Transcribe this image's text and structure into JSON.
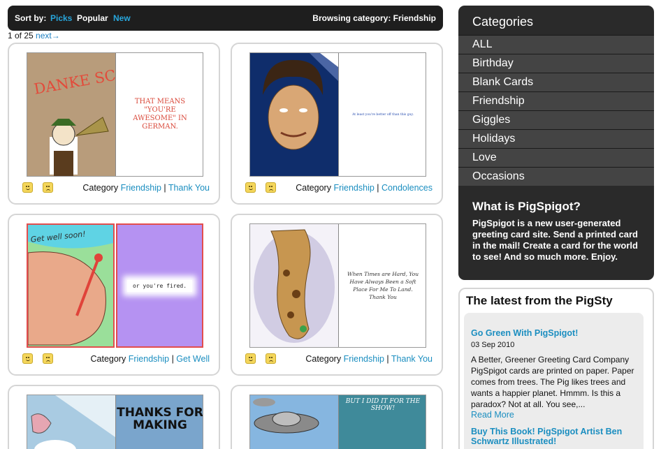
{
  "sortbar": {
    "sort_label": "Sort by:",
    "options": [
      "Picks",
      "Popular",
      "New"
    ],
    "browsing": "Browsing category: Friendship"
  },
  "pager": {
    "text": "1 of 25",
    "next": "next→"
  },
  "cards": [
    {
      "left_text": "DANKE SCHÖEN!",
      "message": "THAT MEANS \"YOU'RE AWESOME\" IN GERMAN.",
      "category_label": "Category",
      "cat1": "Friendship",
      "cat2": "Thank You"
    },
    {
      "message": "At least you're better off than this guy.",
      "category_label": "Category",
      "cat1": "Friendship",
      "cat2": "Condolences"
    },
    {
      "left_text": "Get well soon!",
      "message": "or you're fired.",
      "category_label": "Category",
      "cat1": "Friendship",
      "cat2": "Get Well"
    },
    {
      "message": "When Times are Hard, You Have Always Been a Soft Place For Me To Land. Thank You",
      "category_label": "Category",
      "cat1": "Friendship",
      "cat2": "Thank You"
    },
    {
      "right_text": "THANKS FOR MAKING"
    },
    {
      "right_text": "BUT I DID IT FOR THE SHOW!"
    }
  ],
  "categories": {
    "title": "Categories",
    "items": [
      "ALL",
      "Birthday",
      "Blank Cards",
      "Friendship",
      "Giggles",
      "Holidays",
      "Love",
      "Occasions"
    ],
    "about_title": "What is PigSpigot?",
    "about_text": "PigSpigot is a new user-generated greeting card site. Send a printed card in the mail! Create a card for the world to see! And so much more. Enjoy."
  },
  "blog": {
    "title": "The latest from the PigSty",
    "posts": [
      {
        "title": "Go Green With PigSpigot!",
        "date": "03 Sep 2010",
        "body": "A Better, Greener Greeting Card Company PigSpigot cards are printed on paper. Paper comes from trees. The Pig likes trees and wants a happier planet. Hmmm. Is this a paradox? Not at all. You see,...",
        "more": "Read More"
      },
      {
        "title": "Buy This Book! PigSpigot Artist Ben Schwartz Illustrated!"
      }
    ]
  },
  "colors": {
    "link": "#1b8ec0",
    "dark_panel": "#2a2a2a",
    "menu_item": "#444444",
    "tile_border": "#d5d5d5"
  }
}
